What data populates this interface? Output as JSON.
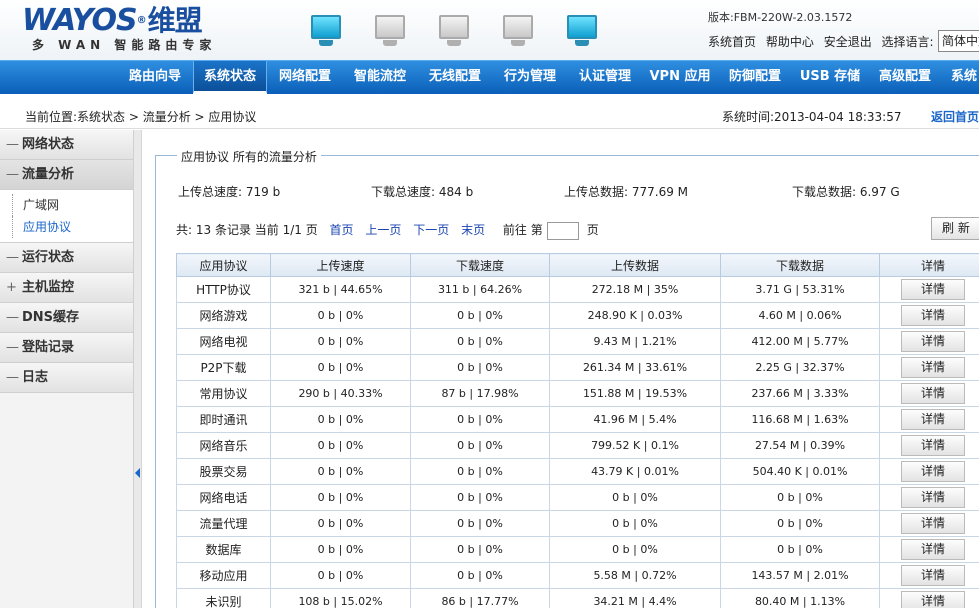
{
  "header": {
    "logo_text": "WAYOS",
    "logo_cn": "维盟",
    "logo_reg": "®",
    "slogan": "多 WAN 智能路由专家",
    "version": "版本:FBM-220W-2.03.1572",
    "links": [
      "系统首页",
      "帮助中心",
      "安全退出",
      "选择语言:"
    ],
    "language_selected": "简体中文"
  },
  "nav": {
    "items": [
      "路由向导",
      "系统状态",
      "网络配置",
      "智能流控",
      "无线配置",
      "行为管理",
      "认证管理",
      "VPN 应用",
      "防御配置",
      "USB 存储",
      "高级配置",
      "系统"
    ],
    "active_index": 1
  },
  "breadcrumb": {
    "text": "当前位置:系统状态 > 流量分析 > 应用协议",
    "system_time": "系统时间:2013-04-04 18:33:57",
    "back_home": "返回首页"
  },
  "sidebar": {
    "items": [
      {
        "marker": "—",
        "label": "网络状态"
      },
      {
        "marker": "—",
        "label": "流量分析"
      },
      {
        "marker": "—",
        "label": "运行状态"
      },
      {
        "marker": "+",
        "label": "主机监控"
      },
      {
        "marker": "—",
        "label": "DNS缓存"
      },
      {
        "marker": "—",
        "label": "登陆记录"
      },
      {
        "marker": "—",
        "label": "日志"
      }
    ],
    "sub_items": [
      "广域网",
      "应用协议"
    ],
    "selected_sub": 1
  },
  "main": {
    "legend": "应用协议 所有的流量分析",
    "stats": {
      "upload_speed": "上传总速度: 719 b",
      "download_speed": "下载总速度: 484 b",
      "upload_data": "上传总数据: 777.69 M",
      "download_data": "下载总数据: 6.97 G"
    },
    "pager": {
      "summary": "共: 13 条记录 当前 1/1 页",
      "first": "首页",
      "prev": "上一页",
      "next": "下一页",
      "last": "末页",
      "goto_prefix": "前往 第",
      "goto_suffix": "页"
    },
    "refresh_label": "刷 新",
    "table": {
      "headers": [
        "应用协议",
        "上传速度",
        "下载速度",
        "上传数据",
        "下载数据",
        "详情"
      ],
      "detail_label": "详情",
      "rows": [
        [
          "HTTP协议",
          "321 b | 44.65%",
          "311 b | 64.26%",
          "272.18 M | 35%",
          "3.71 G | 53.31%"
        ],
        [
          "网络游戏",
          "0 b | 0%",
          "0 b | 0%",
          "248.90 K | 0.03%",
          "4.60 M | 0.06%"
        ],
        [
          "网络电视",
          "0 b | 0%",
          "0 b | 0%",
          "9.43 M | 1.21%",
          "412.00 M | 5.77%"
        ],
        [
          "P2P下载",
          "0 b | 0%",
          "0 b | 0%",
          "261.34 M | 33.61%",
          "2.25 G | 32.37%"
        ],
        [
          "常用协议",
          "290 b | 40.33%",
          "87 b | 17.98%",
          "151.88 M | 19.53%",
          "237.66 M | 3.33%"
        ],
        [
          "即时通讯",
          "0 b | 0%",
          "0 b | 0%",
          "41.96 M | 5.4%",
          "116.68 M | 1.63%"
        ],
        [
          "网络音乐",
          "0 b | 0%",
          "0 b | 0%",
          "799.52 K | 0.1%",
          "27.54 M | 0.39%"
        ],
        [
          "股票交易",
          "0 b | 0%",
          "0 b | 0%",
          "43.79 K | 0.01%",
          "504.40 K | 0.01%"
        ],
        [
          "网络电话",
          "0 b | 0%",
          "0 b | 0%",
          "0 b | 0%",
          "0 b | 0%"
        ],
        [
          "流量代理",
          "0 b | 0%",
          "0 b | 0%",
          "0 b | 0%",
          "0 b | 0%"
        ],
        [
          "数据库",
          "0 b | 0%",
          "0 b | 0%",
          "0 b | 0%",
          "0 b | 0%"
        ],
        [
          "移动应用",
          "0 b | 0%",
          "0 b | 0%",
          "5.58 M | 0.72%",
          "143.57 M | 2.01%"
        ],
        [
          "未识别",
          "108 b | 15.02%",
          "86 b | 17.77%",
          "34.21 M | 4.4%",
          "80.40 M | 1.13%"
        ]
      ]
    }
  }
}
